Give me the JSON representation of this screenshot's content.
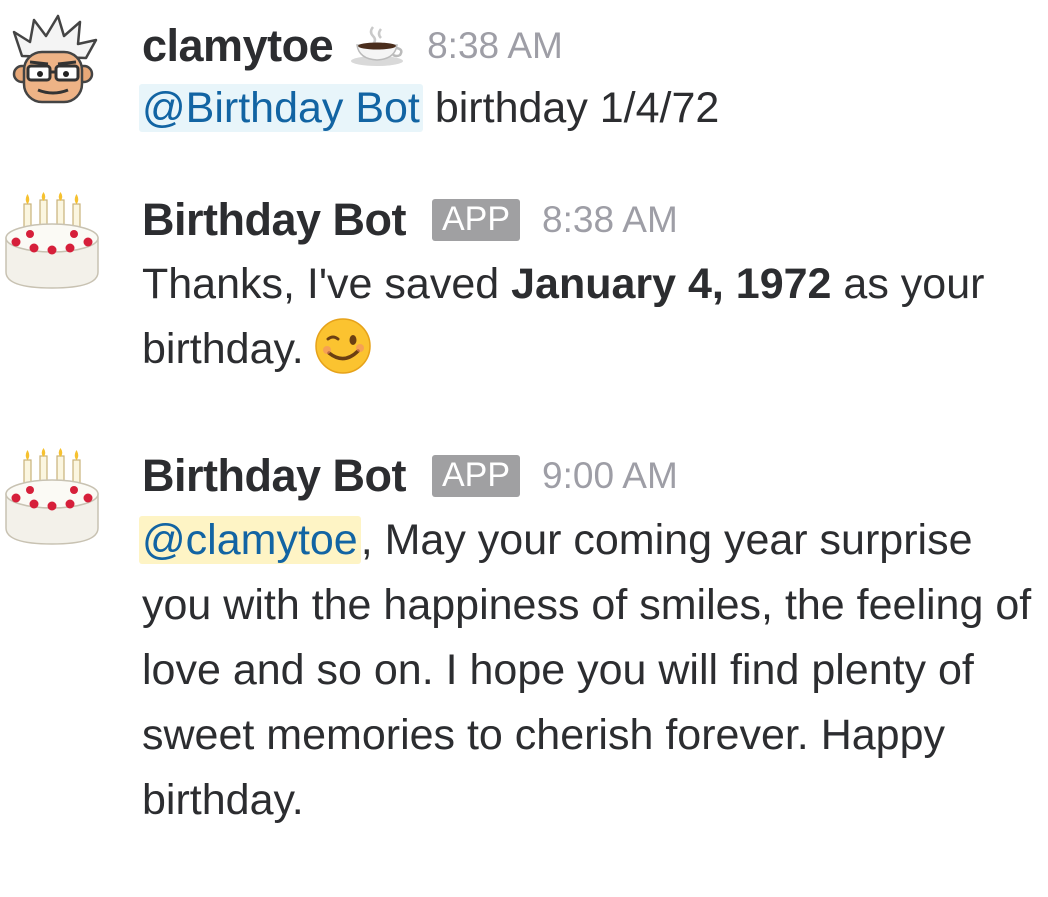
{
  "messages": [
    {
      "username": "clamytoe",
      "status_emoji": "coffee-icon",
      "time": "8:38 AM",
      "mention": "@Birthday Bot",
      "text": " birthday 1/4/72"
    },
    {
      "username": "Birthday Bot",
      "badge": "APP",
      "time": "8:38 AM",
      "text_before": "Thanks, I've saved ",
      "text_bold": "January 4, 1972",
      "text_after": " as your birthday.",
      "emoji": "winking-face-icon"
    },
    {
      "username": "Birthday Bot",
      "badge": "APP",
      "time": "9:00 AM",
      "mention": "@clamytoe",
      "text": ", May your coming year surprise you with the happiness of smiles, the feeling of love and so on. I hope you will find plenty of sweet memories to cherish forever. Happy birthday."
    }
  ],
  "colors": {
    "mention_text": "#1264a3",
    "mention_bg": "#e8f5fa",
    "mention_self_bg": "#fef4c5",
    "timestamp": "#9e9ea6",
    "badge_bg": "#a0a0a2"
  }
}
